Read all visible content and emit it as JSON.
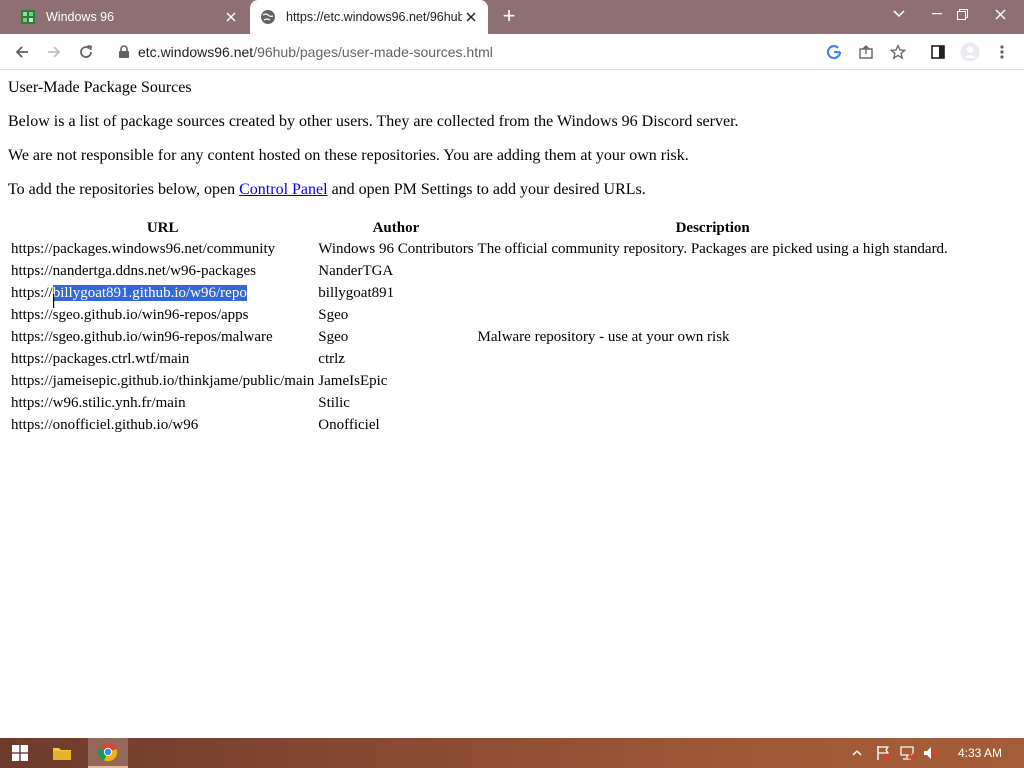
{
  "browser": {
    "tabs": [
      {
        "label": "Windows 96",
        "active": false
      },
      {
        "label": "https://etc.windows96.net/96hub",
        "active": true
      }
    ],
    "address": {
      "host": "etc.windows96.net",
      "path": "/96hub/pages/user-made-sources.html"
    }
  },
  "page": {
    "heading": "User-Made Package Sources",
    "intro": "Below is a list of package sources created by other users. They are collected from the Windows 96 Discord server.",
    "disclaimer": "We are not responsible for any content hosted on these repositories. You are adding them at your own risk.",
    "instructions": {
      "before": "To add the repositories below, open ",
      "link": "Control Panel",
      "after": " and open PM Settings to add your desired URLs."
    },
    "table": {
      "headers": [
        "URL",
        "Author",
        "Description"
      ],
      "rows": [
        {
          "url": "https://packages.windows96.net/community",
          "author": "Windows 96 Contributors",
          "description": "The official community repository. Packages are picked using a high standard."
        },
        {
          "url": "https://nandertga.ddns.net/w96-packages",
          "author": "NanderTGA",
          "description": ""
        },
        {
          "url_prefix": "https://",
          "url_selected": "billygoat891.github.io/w96/repo",
          "author": "billygoat891",
          "description": ""
        },
        {
          "url": "https://sgeo.github.io/win96-repos/apps",
          "author": "Sgeo",
          "description": ""
        },
        {
          "url": "https://sgeo.github.io/win96-repos/malware",
          "author": "Sgeo",
          "description": "Malware repository - use at your own risk"
        },
        {
          "url": "https://packages.ctrl.wtf/main",
          "author": "ctrlz",
          "description": ""
        },
        {
          "url": "https://jameisepic.github.io/thinkjame/public/main",
          "author": "JameIsEpic",
          "description": ""
        },
        {
          "url": "https://w96.stilic.ynh.fr/main",
          "author": "Stilic",
          "description": ""
        },
        {
          "url": "https://onofficiel.github.io/w96",
          "author": "Onofficiel",
          "description": ""
        }
      ]
    }
  },
  "taskbar": {
    "clock": "4:33 AM"
  },
  "colors": {
    "titlebar": "#8e6f73",
    "selection": "#3369d6",
    "link": "#0000ee"
  }
}
